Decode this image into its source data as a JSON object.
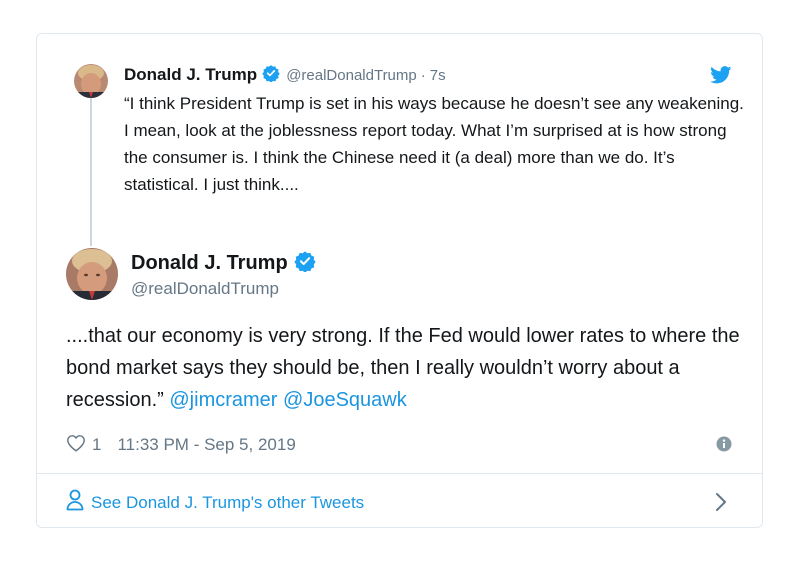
{
  "parent_tweet": {
    "name": "Donald J. Trump",
    "handle": "@realDonaldTrump",
    "dot": "·",
    "time": "7s",
    "text": "“I think President Trump is set in his ways because he doesn’t see any weakening. I mean, look at the joblessness report today. What I’m surprised at is how strong the consumer is. I think the Chinese need it (a deal) more than we do. It’s statistical. I just think...."
  },
  "main_tweet": {
    "name": "Donald J. Trump",
    "handle": "@realDonaldTrump",
    "text": "....that our economy is very strong. If the Fed would lower rates to where the bond market says they should be, then I really wouldn’t worry about a recession.”",
    "mention_1": "@jimcramer",
    "mention_2": "@JoeSquawk",
    "likes": "1",
    "timestamp": "11:33 PM - Sep 5, 2019"
  },
  "footer": {
    "link_label": "See Donald J. Trump's other Tweets"
  },
  "colors": {
    "accent": "#1b95e0",
    "verified": "#1da1f2",
    "muted": "#657786"
  },
  "icons": [
    "twitter-bird-icon",
    "verified-badge-icon",
    "heart-icon",
    "info-icon",
    "person-icon",
    "chevron-right-icon"
  ]
}
